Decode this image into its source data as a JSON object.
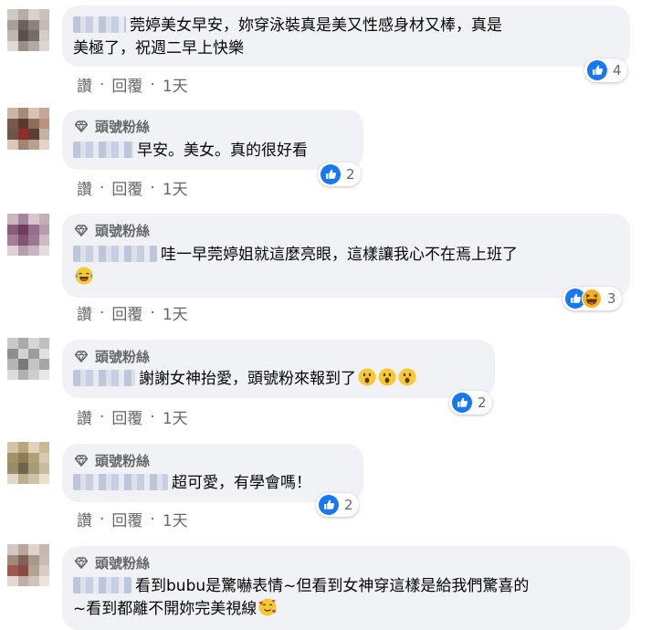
{
  "badge_label": "頭號粉絲",
  "actions": {
    "like": "讚",
    "reply": "回覆",
    "sep": "·",
    "time": "1天"
  },
  "colors": {
    "bubble": "#f0f2f5",
    "meta": "#65676b",
    "like_blue": "#1877f2",
    "haha_yellow": "#f7b125"
  },
  "comments": [
    {
      "text_line1": "莞婷美女早安，妳穿泳裝真是美又性感身材又棒，真是",
      "text_line2": "美極了，祝週二早上快樂",
      "reaction_count": "4",
      "reactions": [
        "like"
      ]
    },
    {
      "text_line1": "早安。美女。真的很好看",
      "reaction_count": "2",
      "reactions": [
        "like"
      ]
    },
    {
      "text_line1": "哇一早莞婷姐就這麼亮眼，這樣讓我心不在焉上班了",
      "trailing_emoji_line2": "joy-emoji",
      "reaction_count": "3",
      "reactions": [
        "like",
        "haha"
      ]
    },
    {
      "text_line1": "謝謝女神抬愛，頭號粉來報到了",
      "trailing_emojis": [
        "surprised-emoji",
        "surprised-emoji",
        "surprised-emoji"
      ],
      "reaction_count": "2",
      "reactions": [
        "like"
      ]
    },
    {
      "text_line1": "超可愛，有學會嗎！",
      "reaction_count": "2",
      "reactions": [
        "like"
      ]
    },
    {
      "text_line1": "看到bubu是驚嚇表情~但看到女神穿這樣是給我們驚喜的",
      "text_line2": "~看到都離不開妳完美視線",
      "trailing_emoji_line2": "smiling-hearts-emoji"
    }
  ]
}
